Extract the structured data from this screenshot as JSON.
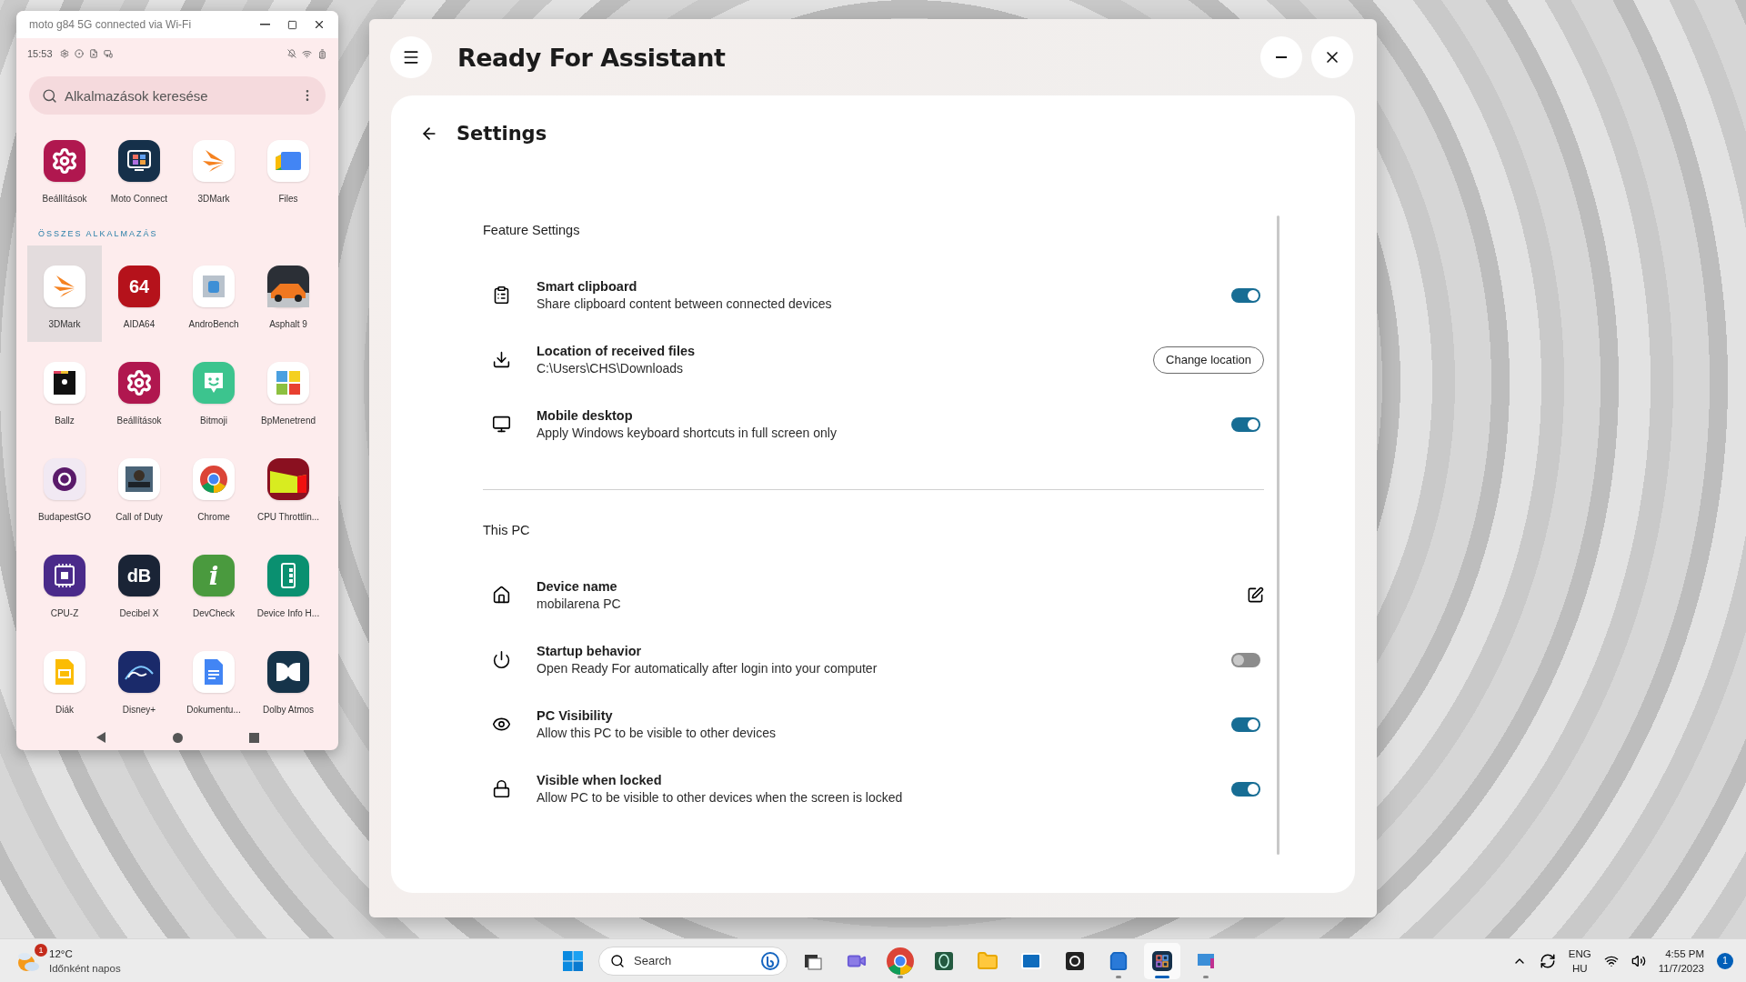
{
  "phone_window": {
    "title": "moto g84 5G connected via Wi-Fi",
    "status_time": "15:53",
    "search": {
      "placeholder": "Alkalmazások keresése"
    },
    "favorites": [
      {
        "name": "Beállítások",
        "kind": "gear",
        "color": "#b0174f"
      },
      {
        "name": "Moto Connect",
        "kind": "tiles",
        "color": "#15304a"
      },
      {
        "name": "3DMark",
        "kind": "chevrons",
        "color": "#ffffff"
      },
      {
        "name": "Files",
        "kind": "folder",
        "color": "#ffffff"
      }
    ],
    "section_title": "ÖSSZES ALKALMAZÁS",
    "apps": [
      {
        "name": "3DMark",
        "kind": "chevrons",
        "color": "#ffffff",
        "selected": true
      },
      {
        "name": "AIDA64",
        "kind": "glyph",
        "glyph": "64",
        "color": "#b5121b",
        "selected": false
      },
      {
        "name": "AndroBench",
        "kind": "robot",
        "color": "#ffffff",
        "selected": false
      },
      {
        "name": "Asphalt 9",
        "kind": "car",
        "color": "#2b2f36",
        "selected": false
      },
      {
        "name": "Ballz",
        "kind": "block",
        "color": "#ffffff",
        "selected": false
      },
      {
        "name": "Beállítások",
        "kind": "gear",
        "color": "#b0174f",
        "selected": false
      },
      {
        "name": "Bitmoji",
        "kind": "chat",
        "color": "#3cc48e",
        "selected": false
      },
      {
        "name": "BpMenetrend",
        "kind": "grid4",
        "color": "#ffffff",
        "selected": false
      },
      {
        "name": "BudapestGO",
        "kind": "ring",
        "color": "#f1e9f3",
        "selected": false
      },
      {
        "name": "Call of Duty",
        "kind": "helmet",
        "color": "#ffffff",
        "selected": false
      },
      {
        "name": "Chrome",
        "kind": "chrome",
        "color": "#ffffff",
        "selected": false
      },
      {
        "name": "CPU Throttlin...",
        "kind": "chart",
        "color": "#8a1020",
        "selected": false
      },
      {
        "name": "CPU-Z",
        "kind": "chip",
        "color": "#4a2a8a",
        "selected": false
      },
      {
        "name": "Decibel X",
        "kind": "glyph",
        "glyph": "dB",
        "color": "#1a2436",
        "selected": false
      },
      {
        "name": "DevCheck",
        "kind": "glyph",
        "glyph": "i",
        "color": "#4a9a3e",
        "selected": false
      },
      {
        "name": "Device Info H...",
        "kind": "phone",
        "color": "#0a9070",
        "selected": false
      },
      {
        "name": "Diák",
        "kind": "slide",
        "color": "#ffffff",
        "selected": false
      },
      {
        "name": "Disney+",
        "kind": "arc",
        "color": "#1a2a6a",
        "selected": false
      },
      {
        "name": "Dokumentu...",
        "kind": "doc",
        "color": "#ffffff",
        "selected": false
      },
      {
        "name": "Dolby Atmos",
        "kind": "dolby",
        "color": "#16344a",
        "selected": false
      }
    ]
  },
  "assistant_window": {
    "title": "Ready For Assistant",
    "page_title": "Settings",
    "sections": [
      {
        "title": "Feature Settings",
        "rows": [
          {
            "kind": "toggle",
            "title": "Smart clipboard",
            "subtitle": "Share clipboard content between connected devices",
            "on": true
          },
          {
            "kind": "button",
            "title": "Location of received files",
            "subtitle": "C:\\Users\\CHS\\Downloads",
            "button_label": "Change location"
          },
          {
            "kind": "toggle",
            "title": "Mobile desktop",
            "subtitle": "Apply Windows keyboard shortcuts in full screen only",
            "on": true
          }
        ]
      },
      {
        "title": "This PC",
        "rows": [
          {
            "kind": "edit",
            "title": "Device name",
            "subtitle": "mobilarena PC"
          },
          {
            "kind": "toggle",
            "title": "Startup behavior",
            "subtitle": "Open Ready For automatically after login into your computer",
            "on": false
          },
          {
            "kind": "toggle",
            "title": "PC Visibility",
            "subtitle": "Allow this PC to be visible to other devices",
            "on": true
          },
          {
            "kind": "toggle",
            "title": "Visible when locked",
            "subtitle": "Allow PC to be visible to other devices when the screen is locked",
            "on": true
          }
        ]
      }
    ]
  },
  "taskbar": {
    "weather": {
      "badge": "1",
      "temperature": "12°C",
      "condition": "Időnként napos"
    },
    "search": {
      "placeholder": "Search"
    },
    "apps": [
      {
        "running": false,
        "selected": false
      },
      {
        "running": false,
        "selected": false
      },
      {
        "running": true,
        "selected": false
      },
      {
        "running": false,
        "selected": false
      },
      {
        "running": false,
        "selected": false
      },
      {
        "running": false,
        "selected": false
      },
      {
        "running": false,
        "selected": false
      },
      {
        "running": true,
        "selected": false
      },
      {
        "running": true,
        "selected": true
      },
      {
        "running": true,
        "selected": false
      }
    ],
    "language": [
      "ENG",
      "HU"
    ],
    "time": "4:55 PM",
    "date": "11/7/2023",
    "notifications": "1"
  }
}
